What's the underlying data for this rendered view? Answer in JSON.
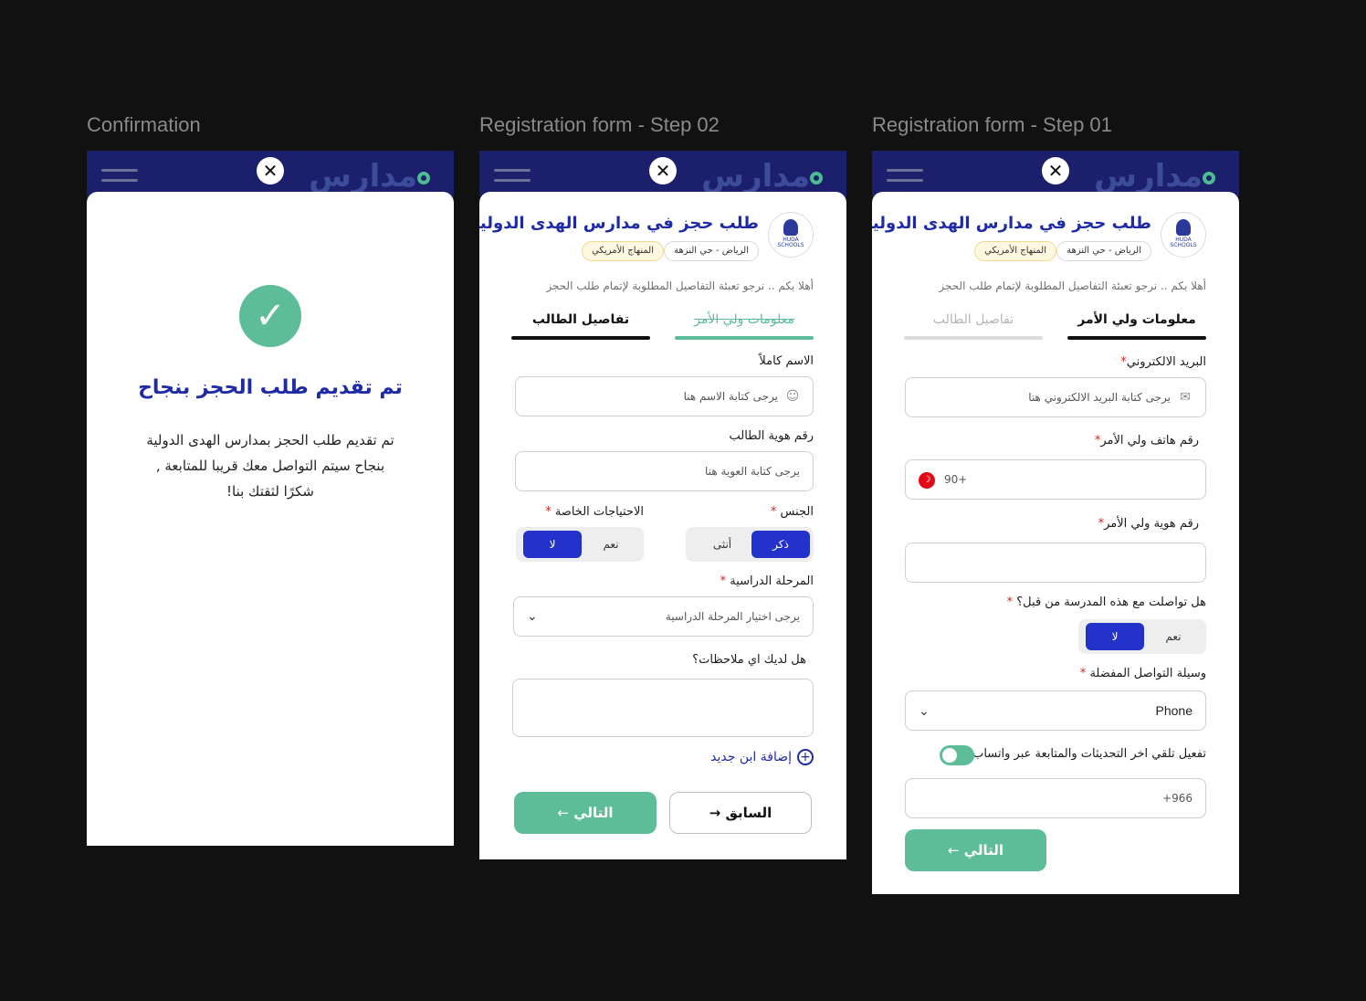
{
  "frames": {
    "confirmation": {
      "label": "Confirmation"
    },
    "step2": {
      "label": "Registration form - Step 02"
    },
    "step1": {
      "label": "Registration form - Step 01"
    }
  },
  "topbar": {
    "brand": "مدارس",
    "close_glyph": "✕"
  },
  "header": {
    "title": "طلب حجز في مدارس الهدى الدولية",
    "logo_text": "HUDA SCHOOLS",
    "chip_location": "الرياض - حي النزهة",
    "chip_curriculum": "المنهاج الأمريكي",
    "intro": "أهلا بكم .. نرجو تعبئة التفاصيل المطلوبة لإتمام طلب الحجز"
  },
  "tabs": {
    "guardian": "معلومات ولي الأمر",
    "student": "تفاصيل الطالب"
  },
  "confirmation": {
    "check_glyph": "✓",
    "title": "تم تقديم طلب الحجز بنجاح",
    "line1": "تم تقديم طلب الحجز بمدارس الهدى الدولية",
    "line2": "بنجاح سيتم التواصل معك قريبا للمتابعة ,",
    "line3": "شكرًا لثقتك بنا!"
  },
  "step2": {
    "fullname_label": "الاسم كاملاً",
    "fullname_placeholder": "يرجى كتابة الاسم هنا",
    "student_id_label": "رقم هوية الطالب",
    "student_id_placeholder": "يرجى كتابة العوية هنا",
    "gender_label": "الجنس",
    "gender_male": "ذكر",
    "gender_female": "أنثى",
    "special_needs_label": "الاحتياجات الخاصة",
    "yes": "نعم",
    "no": "لا",
    "stage_label": "المرحلة الدراسية",
    "stage_placeholder": "يرجى اختيار المرحلة الدراسية",
    "notes_label": "هل لديك اي ملاحظات؟",
    "add_child": "إضافة ابن جديد",
    "next": "التالي",
    "prev": "السابق"
  },
  "step1": {
    "email_label": "البريد الالكتروني",
    "email_placeholder": "يرجى كتابة البريد الالكتروني هنا",
    "phone_label": "رقم هاتف ولي الأمر",
    "phone_value": "+90",
    "guardian_id_label": "رقم هوية ولي الأمر",
    "contacted_label": "هل تواصلت مع هذه المدرسة من قبل؟",
    "yes": "نعم",
    "no": "لا",
    "contact_method_label": "وسيلة التواصل المفضلة",
    "contact_method_value": "Phone",
    "whatsapp_label": "تفعيل تلقي اخر التحديثات والمتابعة عبر واتساب",
    "whatsapp_value": "+966",
    "whatsapp_enabled": true,
    "next": "التالي"
  },
  "colors": {
    "navy": "#1c1f6c",
    "primary_blue": "#2432cc",
    "title_blue": "#1f2aa6",
    "green": "#5cbd98",
    "required": "#d62020"
  }
}
